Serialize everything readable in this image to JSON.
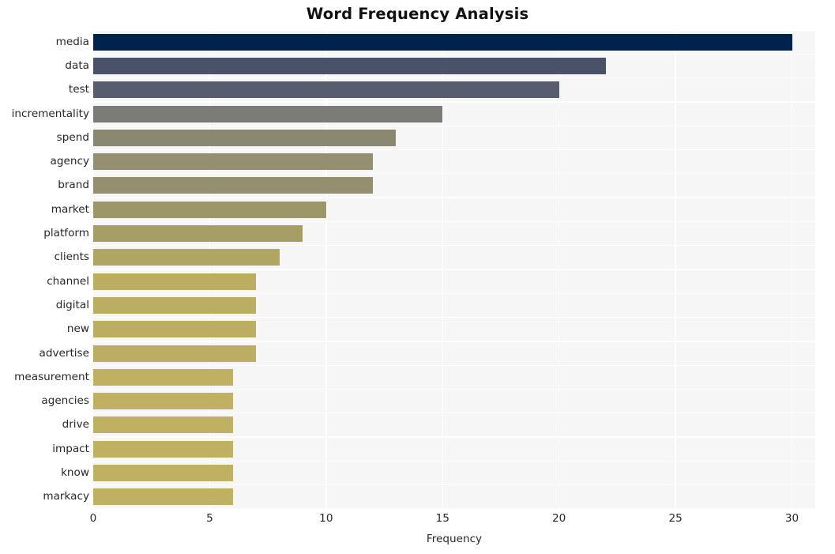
{
  "chart_data": {
    "type": "bar",
    "orientation": "horizontal",
    "title": "Word Frequency Analysis",
    "xlabel": "Frequency",
    "ylabel": "",
    "xlim": [
      0,
      31
    ],
    "xticks": [
      0,
      5,
      10,
      15,
      20,
      25,
      30
    ],
    "xticklabels": [
      "0",
      "5",
      "10",
      "15",
      "20",
      "25",
      "30"
    ],
    "grid": true,
    "grid_color": "#ffffff",
    "plot_background": "#f6f6f7",
    "figure_background": "#ffffff",
    "legend": null,
    "categories": [
      "media",
      "data",
      "test",
      "incrementality",
      "spend",
      "agency",
      "brand",
      "market",
      "platform",
      "clients",
      "channel",
      "digital",
      "new",
      "advertise",
      "measurement",
      "agencies",
      "drive",
      "impact",
      "know",
      "markacy"
    ],
    "values": [
      30,
      22,
      20,
      15,
      13,
      12,
      12,
      10,
      9,
      8,
      7,
      7,
      7,
      7,
      6,
      6,
      6,
      6,
      6,
      6
    ],
    "bar_colors": [
      "#00224e",
      "#4a5269",
      "#575c6e",
      "#7b7b78",
      "#8b8872",
      "#938f6f",
      "#938f6f",
      "#9c9669",
      "#a69e66",
      "#b0a663",
      "#bbae62",
      "#bbae62",
      "#bbae62",
      "#bbae62",
      "#c0b162",
      "#c0b162",
      "#c0b162",
      "#c0b162",
      "#c0b162",
      "#c0b162"
    ]
  }
}
